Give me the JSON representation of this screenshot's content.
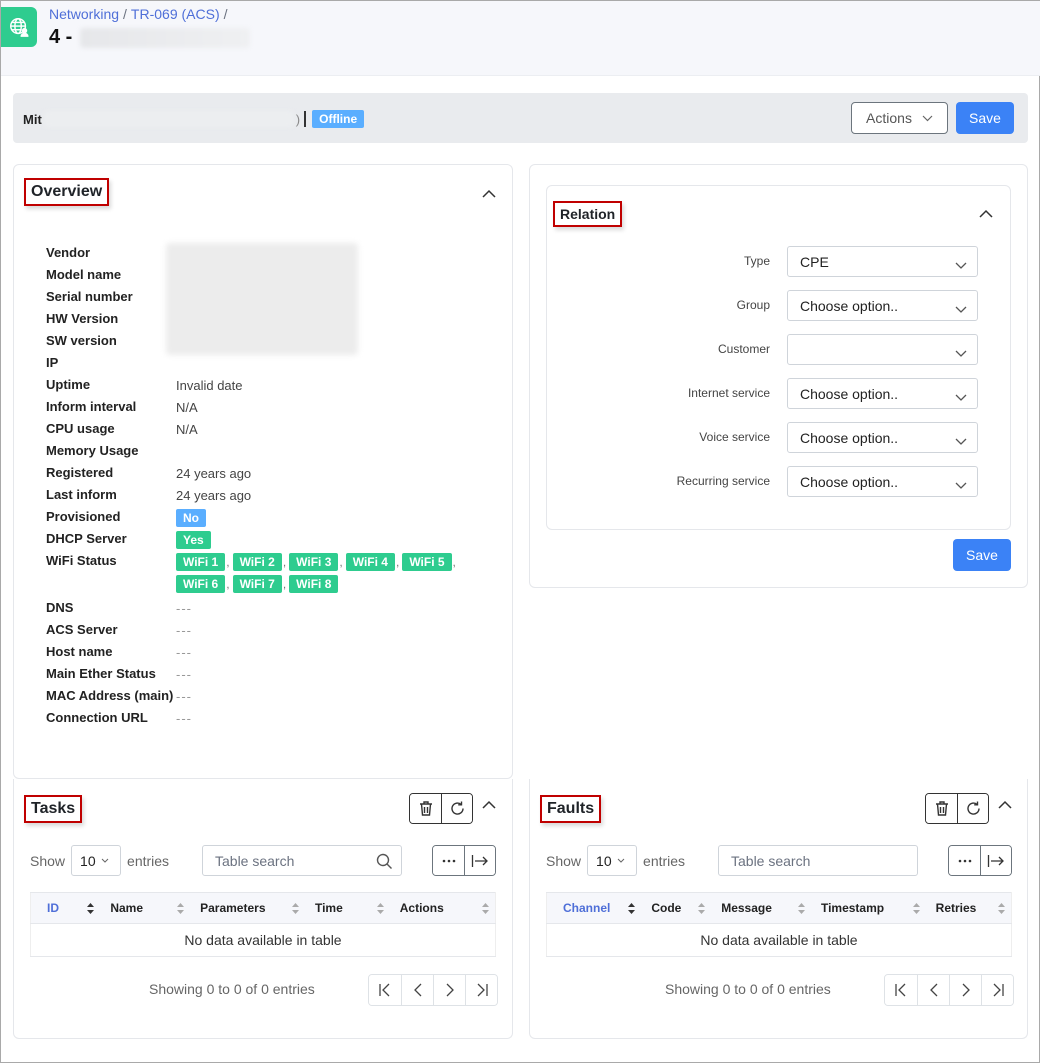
{
  "header": {
    "app_icon": "globe-user-icon",
    "breadcrumb": [
      "Networking",
      "TR-069 (ACS)"
    ],
    "title_prefix": "4 -"
  },
  "device_bar": {
    "name_prefix": "Mit",
    "name_suffix": ")",
    "status": "Offline",
    "actions_label": "Actions",
    "save_label": "Save"
  },
  "overview": {
    "title": "Overview",
    "rows": [
      {
        "label": "Vendor",
        "value": ""
      },
      {
        "label": "Model name",
        "value": ""
      },
      {
        "label": "Serial number",
        "value": ""
      },
      {
        "label": "HW Version",
        "value": ""
      },
      {
        "label": "SW version",
        "value": ""
      },
      {
        "label": "IP",
        "value": ""
      },
      {
        "label": "Uptime",
        "value": "Invalid date"
      },
      {
        "label": "Inform interval",
        "value": "N/A"
      },
      {
        "label": "CPU usage",
        "value": "N/A"
      },
      {
        "label": "Memory Usage",
        "value": ""
      },
      {
        "label": "Registered",
        "value": "24 years ago"
      },
      {
        "label": "Last inform",
        "value": "24 years ago"
      }
    ],
    "provisioned": {
      "label": "Provisioned",
      "value": "No"
    },
    "dhcp_server": {
      "label": "DHCP Server",
      "value": "Yes"
    },
    "wifi_status": {
      "label": "WiFi Status",
      "items": [
        "WiFi 1",
        "WiFi 2",
        "WiFi 3",
        "WiFi 4",
        "WiFi 5",
        "WiFi 6",
        "WiFi 7",
        "WiFi 8"
      ]
    },
    "rows_after": [
      {
        "label": "DNS",
        "value": "---"
      },
      {
        "label": "ACS Server",
        "value": "---"
      },
      {
        "label": "Host name",
        "value": "---"
      },
      {
        "label": "Main Ether Status",
        "value": "---"
      },
      {
        "label": "MAC Address (main)",
        "value": "---"
      },
      {
        "label": "Connection URL",
        "value": "---"
      }
    ]
  },
  "relation": {
    "title": "Relation",
    "fields": [
      {
        "label": "Type",
        "value": "CPE"
      },
      {
        "label": "Group",
        "value": "Choose option.."
      },
      {
        "label": "Customer",
        "value": ""
      },
      {
        "label": "Internet service",
        "value": "Choose option.."
      },
      {
        "label": "Voice service",
        "value": "Choose option.."
      },
      {
        "label": "Recurring service",
        "value": "Choose option.."
      }
    ],
    "save_label": "Save"
  },
  "tasks": {
    "title": "Tasks",
    "show_label": "Show",
    "entries_value": "10",
    "entries_label": "entries",
    "search_placeholder": "Table search",
    "columns": [
      "ID",
      "Name",
      "Parameters",
      "Time",
      "Actions"
    ],
    "empty_text": "No data available in table",
    "info": "Showing 0 to 0 of 0 entries"
  },
  "faults": {
    "title": "Faults",
    "show_label": "Show",
    "entries_value": "10",
    "entries_label": "entries",
    "search_placeholder": "Table search",
    "columns": [
      "Channel",
      "Code",
      "Message",
      "Timestamp",
      "Retries"
    ],
    "empty_text": "No data available in table",
    "info": "Showing 0 to 0 of 0 entries"
  },
  "colors": {
    "accent": "#3b82f6",
    "success": "#2ecc8f",
    "info": "#5aaeff",
    "link": "#4f6fd8",
    "highlight_border": "#c00000"
  }
}
